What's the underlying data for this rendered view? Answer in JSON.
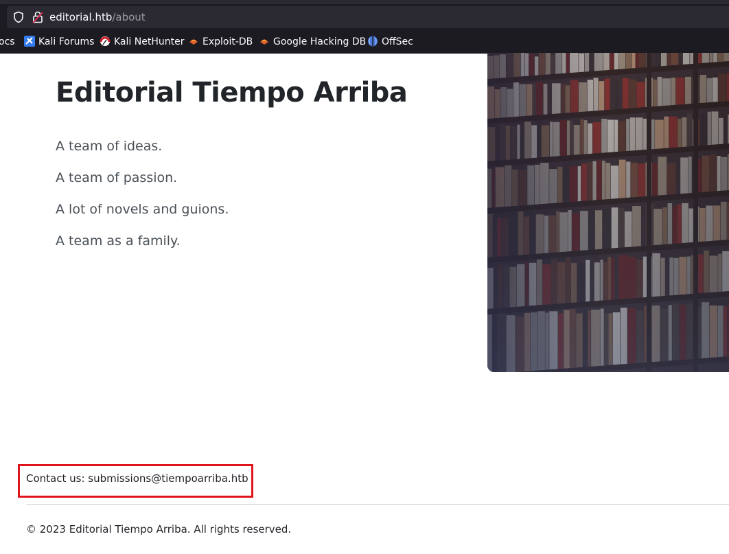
{
  "browser": {
    "url_host": "editorial.htb",
    "url_path": "/about",
    "bookmarks": [
      {
        "label": "ocs",
        "icon": "docs-icon"
      },
      {
        "label": "Kali Forums",
        "icon": "kali-forums-icon"
      },
      {
        "label": "Kali NetHunter",
        "icon": "kali-nethunter-icon"
      },
      {
        "label": "Exploit-DB",
        "icon": "exploit-db-icon"
      },
      {
        "label": "Google Hacking DB",
        "icon": "google-hacking-db-icon"
      },
      {
        "label": "OffSec",
        "icon": "offsec-icon"
      }
    ]
  },
  "page": {
    "title": "Editorial Tiempo Arriba",
    "taglines": [
      "A team of ideas.",
      "A team of passion.",
      "A lot of novels and guions.",
      "A team as a family."
    ],
    "hero_image": "bookshelf-photo",
    "contact": "Contact us: submissions@tiempoarriba.htb",
    "footer": "© 2023 Editorial Tiempo Arriba. All rights reserved.",
    "highlight_color": "#e0141b"
  }
}
